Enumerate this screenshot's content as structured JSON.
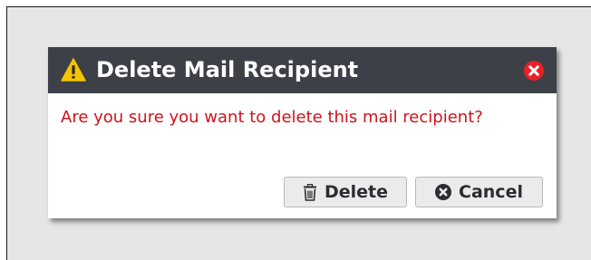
{
  "dialog": {
    "title": "Delete Mail Recipient",
    "title_icon": "warning-icon",
    "close_icon": "close-icon",
    "message": "Are you sure you want to delete this mail recipient?",
    "buttons": {
      "delete_label": "Delete",
      "delete_icon": "trash-icon",
      "cancel_label": "Cancel",
      "cancel_icon": "cancel-icon"
    },
    "colors": {
      "header_bg": "#3d4046",
      "title_text": "#ffffff",
      "warning_yellow": "#f5c400",
      "close_red": "#e8202a",
      "message_red": "#d0121b",
      "button_bg": "#ebebeb",
      "button_text": "#2b2d30"
    }
  }
}
